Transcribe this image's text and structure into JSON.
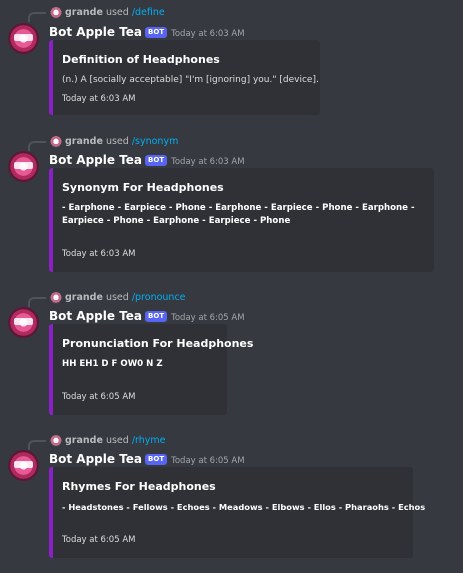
{
  "messages": [
    {
      "reply_user": "grande",
      "reply_used": "used",
      "reply_command": "/define",
      "author": "Bot Apple Tea",
      "bot_tag": "BOT",
      "timestamp": "Today at 6:03 AM",
      "embed_title": "Definition of Headphones",
      "embed_description": "(n.) A [socially acceptable] \"I'm [ignoring] you.\" [device].",
      "embed_footer": "Today at 6:03 AM"
    },
    {
      "reply_user": "grande",
      "reply_used": "used",
      "reply_command": "/synonym",
      "author": "Bot Apple Tea",
      "bot_tag": "BOT",
      "timestamp": "Today at 6:03 AM",
      "embed_title": "Synonym For Headphones",
      "embed_description": "- Earphone - Earpiece - Phone - Earphone - Earpiece - Phone - Earphone - Earpiece - Phone - Earphone - Earpiece - Phone",
      "embed_footer": "Today at 6:03 AM"
    },
    {
      "reply_user": "grande",
      "reply_used": "used",
      "reply_command": "/pronounce",
      "author": "Bot Apple Tea",
      "bot_tag": "BOT",
      "timestamp": "Today at 6:05 AM",
      "embed_title": "Pronunciation For Headphones",
      "embed_description": "HH EH1 D F OW0 N Z",
      "embed_footer": "Today at 6:05 AM"
    },
    {
      "reply_user": "grande",
      "reply_used": "used",
      "reply_command": "/rhyme",
      "author": "Bot Apple Tea",
      "bot_tag": "BOT",
      "timestamp": "Today at 6:05 AM",
      "embed_title": "Rhymes For Headphones",
      "embed_description": "- Headstones - Fellows - Echoes - Meadows - Elbows - Ellos - Pharaohs - Echos",
      "embed_footer": "Today at 6:05 AM"
    }
  ],
  "colors": {
    "background": "#36393f",
    "embed_background": "#2f3136",
    "embed_accent": "#8b1fc8",
    "command_link": "#00aff4",
    "bot_tag": "#5865f2"
  }
}
